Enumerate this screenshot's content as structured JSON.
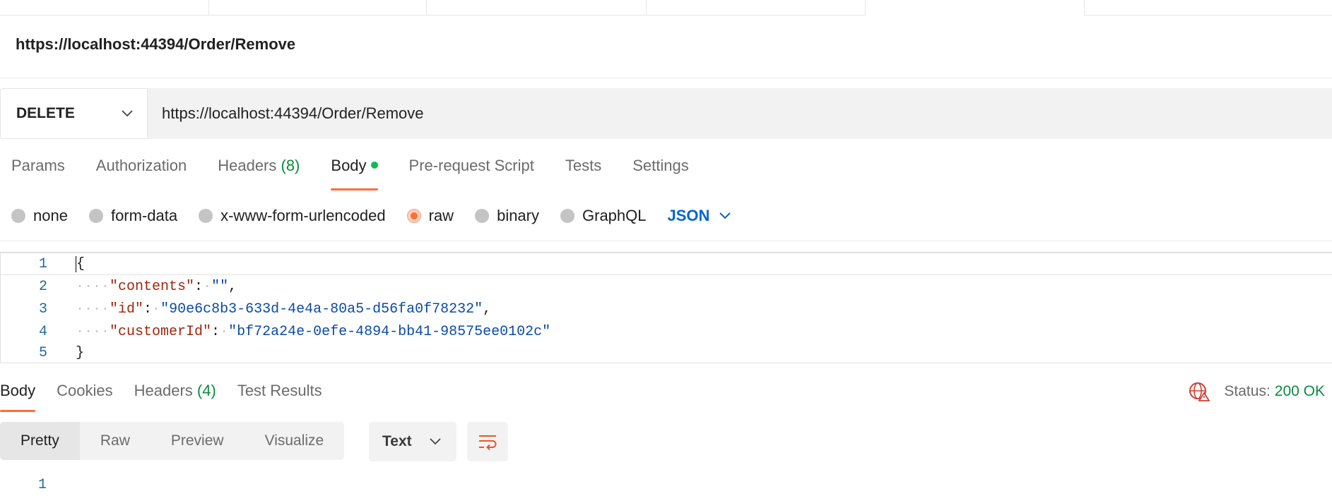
{
  "request": {
    "title": "https://localhost:44394/Order/Remove",
    "method": "DELETE",
    "url": "https://localhost:44394/Order/Remove"
  },
  "request_tabs": {
    "params": "Params",
    "authorization": "Authorization",
    "headers": "Headers",
    "headers_count": "(8)",
    "body": "Body",
    "prerequest": "Pre-request Script",
    "tests": "Tests",
    "settings": "Settings"
  },
  "body_types": {
    "none": "none",
    "form_data": "form-data",
    "urlencoded": "x-www-form-urlencoded",
    "raw": "raw",
    "binary": "binary",
    "graphql": "GraphQL",
    "selected": "raw",
    "language": "JSON"
  },
  "editor": {
    "line_numbers": [
      "1",
      "2",
      "3",
      "4",
      "5"
    ],
    "open_brace": "{",
    "close_brace": "}",
    "fields": [
      {
        "key": "\"contents\"",
        "value": "\"\""
      },
      {
        "key": "\"id\"",
        "value": "\"90e6c8b3-633d-4e4a-80a5-d56fa0f78232\""
      },
      {
        "key": "\"customerId\"",
        "value": "\"bf72a24e-0efe-4894-bb41-98575ee0102c\""
      }
    ]
  },
  "response": {
    "tabs": {
      "body": "Body",
      "cookies": "Cookies",
      "headers": "Headers",
      "headers_count": "(4)",
      "test_results": "Test Results"
    },
    "status_label": "Status:",
    "status_value": "200 OK",
    "views": {
      "pretty": "Pretty",
      "raw": "Raw",
      "preview": "Preview",
      "visualize": "Visualize"
    },
    "format": "Text",
    "line_number": "1"
  },
  "colors": {
    "accent": "#ff6c37",
    "success": "#0b8a3e",
    "link_blue": "#0265d2"
  },
  "icons": {
    "method_dropdown": "chevron-down-icon",
    "json_dropdown": "chevron-down-icon",
    "format_dropdown": "chevron-down-icon",
    "globe": "globe-error-icon",
    "wrap": "wrap-lines-icon"
  }
}
